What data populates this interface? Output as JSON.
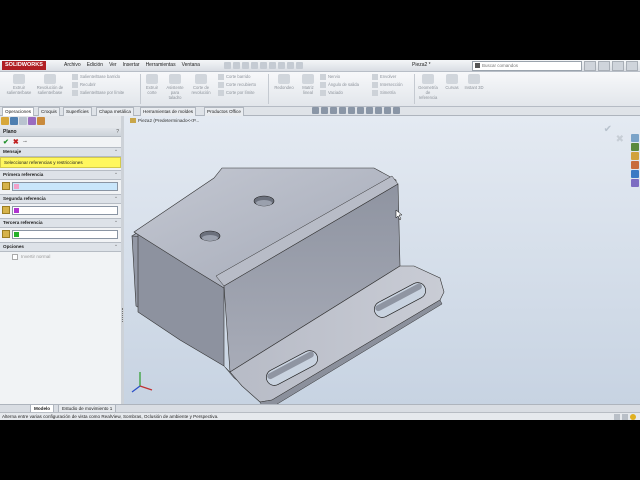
{
  "app": {
    "logo": "SOLIDWORKS",
    "menu": [
      "Archivo",
      "Edición",
      "Ver",
      "Insertar",
      "Herramientas",
      "Ventana"
    ],
    "document_title": "Pieza2 *",
    "search_placeholder": "Buscar comandos"
  },
  "ribbon": {
    "big_buttons": [
      "Extruir saliente/base",
      "Revolución de saliente/base",
      "Extruir corte",
      "Asistente para taladro",
      "Corte de revolución",
      "Redondeo",
      "Matriz lineal",
      "Envolver",
      "Geometría de referencia",
      "Curvas",
      "Instant 3D"
    ],
    "small_buttons": [
      "Saliente/Base barrido",
      "Recubrir",
      "Saliente/Base por límite",
      "Corte barrido",
      "Corte recubierto",
      "Corte por límite",
      "Nervio",
      "Ángulo de salida",
      "Vaciado",
      "Intersección",
      "Simetría"
    ]
  },
  "tabs": [
    "Operaciones",
    "Croquis",
    "Superficies",
    "Chapa metálica",
    "Herramientas de moldes",
    "Productos Office"
  ],
  "active_tab": "Operaciones",
  "property_manager": {
    "title": "Plano",
    "message_header": "Mensaje",
    "message": "Seleccionar referencias y restricciones",
    "refs": [
      {
        "label": "Primera referencia",
        "color": "#f2a0c8"
      },
      {
        "label": "Segunda referencia",
        "color": "#b034d0"
      },
      {
        "label": "Tercera referencia",
        "color": "#22b02a"
      }
    ],
    "options_header": "Opciones",
    "options_checkbox": "Invertir normal"
  },
  "viewport": {
    "tree_label": "Pieza2  (Predeterminado<<P...",
    "background_top": "#e4eaf2",
    "background_bottom": "#c7d3e2",
    "part_color": "#a9afbd"
  },
  "bottom_tabs": [
    "Modelo",
    "Estudio de movimiento 1"
  ],
  "status_text": "Alterna entre varias configuración de vista como RealView, Sombras, Oclusión de ambiente y Perspectiva."
}
